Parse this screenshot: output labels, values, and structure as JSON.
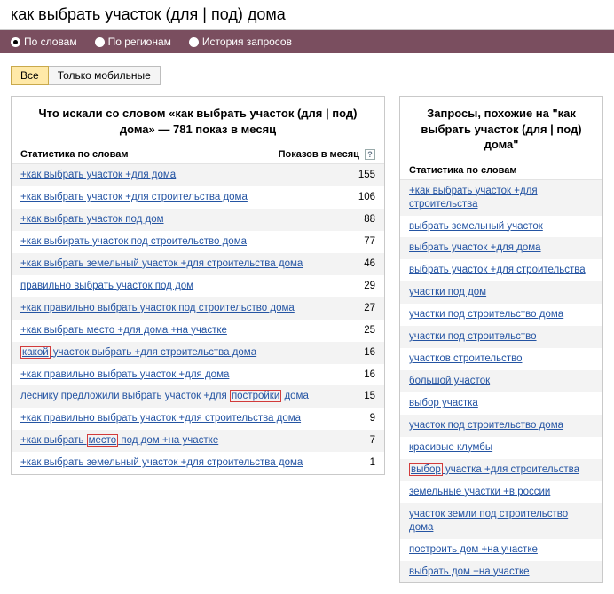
{
  "search": {
    "value": "как выбрать участок (для | под) дома"
  },
  "filters": {
    "words": "По словам",
    "regions": "По регионам",
    "history": "История запросов"
  },
  "tabs": {
    "all": "Все",
    "mobile": "Только мобильные"
  },
  "left": {
    "title": "Что искали со словом «как выбрать участок (для | под) дома» — 781 показ в месяц",
    "col1": "Статистика по словам",
    "col2": "Показов в месяц",
    "rows": [
      {
        "text": "+как выбрать участок +для дома",
        "count": "155"
      },
      {
        "text": "+как выбрать участок +для строительства дома",
        "count": "106"
      },
      {
        "text": "+как выбрать участок под дом",
        "count": "88"
      },
      {
        "text": "+как выбирать участок под строительство дома",
        "count": "77"
      },
      {
        "text": "+как выбрать земельный участок +для строительства дома",
        "count": "46"
      },
      {
        "text": "правильно выбрать участок под дом",
        "count": "29"
      },
      {
        "text": "+как правильно выбрать участок под строительство дома",
        "count": "27"
      },
      {
        "text": "+как выбрать место +для дома +на участке",
        "count": "25"
      },
      {
        "pre": "какой",
        "mid": " участок выбрать +для строительства дома",
        "count": "16",
        "hlFirst": true
      },
      {
        "text": "+как правильно выбрать участок +для дома",
        "count": "16"
      },
      {
        "pre": "леснику предложили выбрать участок +для ",
        "hlWord": "постройки",
        "post": " дома",
        "count": "15",
        "hlMid": true
      },
      {
        "text": "+как правильно выбрать участок +для строительства дома",
        "count": "9"
      },
      {
        "pre": "+как выбрать ",
        "hlWord": "место",
        "post": " под дом +на участке",
        "count": "7",
        "hlMid": true
      },
      {
        "text": "+как выбрать земельный участок +для строительства дома",
        "count": "1"
      }
    ]
  },
  "right": {
    "title": "Запросы, похожие на \"как выбрать участок (для | под) дома\"",
    "col1": "Статистика по словам",
    "rows": [
      {
        "text": "+как выбрать участок +для строительства"
      },
      {
        "text": "выбрать земельный участок"
      },
      {
        "text": "выбрать участок +для дома"
      },
      {
        "text": "выбрать участок +для строительства"
      },
      {
        "text": "участки под дом"
      },
      {
        "text": "участки под строительство дома"
      },
      {
        "text": "участки под строительство"
      },
      {
        "text": "участков строительство"
      },
      {
        "text": "большой участок"
      },
      {
        "text": "выбор участка"
      },
      {
        "text": "участок под строительство дома"
      },
      {
        "text": "красивые клумбы"
      },
      {
        "pre": "выбор",
        "mid": " участка +для строительства",
        "hlFirst": true
      },
      {
        "text": "земельные участки +в россии"
      },
      {
        "text": "участок земли под строительство дома"
      },
      {
        "text": "построить дом +на участке"
      },
      {
        "text": "выбрать дом +на участке"
      }
    ]
  }
}
